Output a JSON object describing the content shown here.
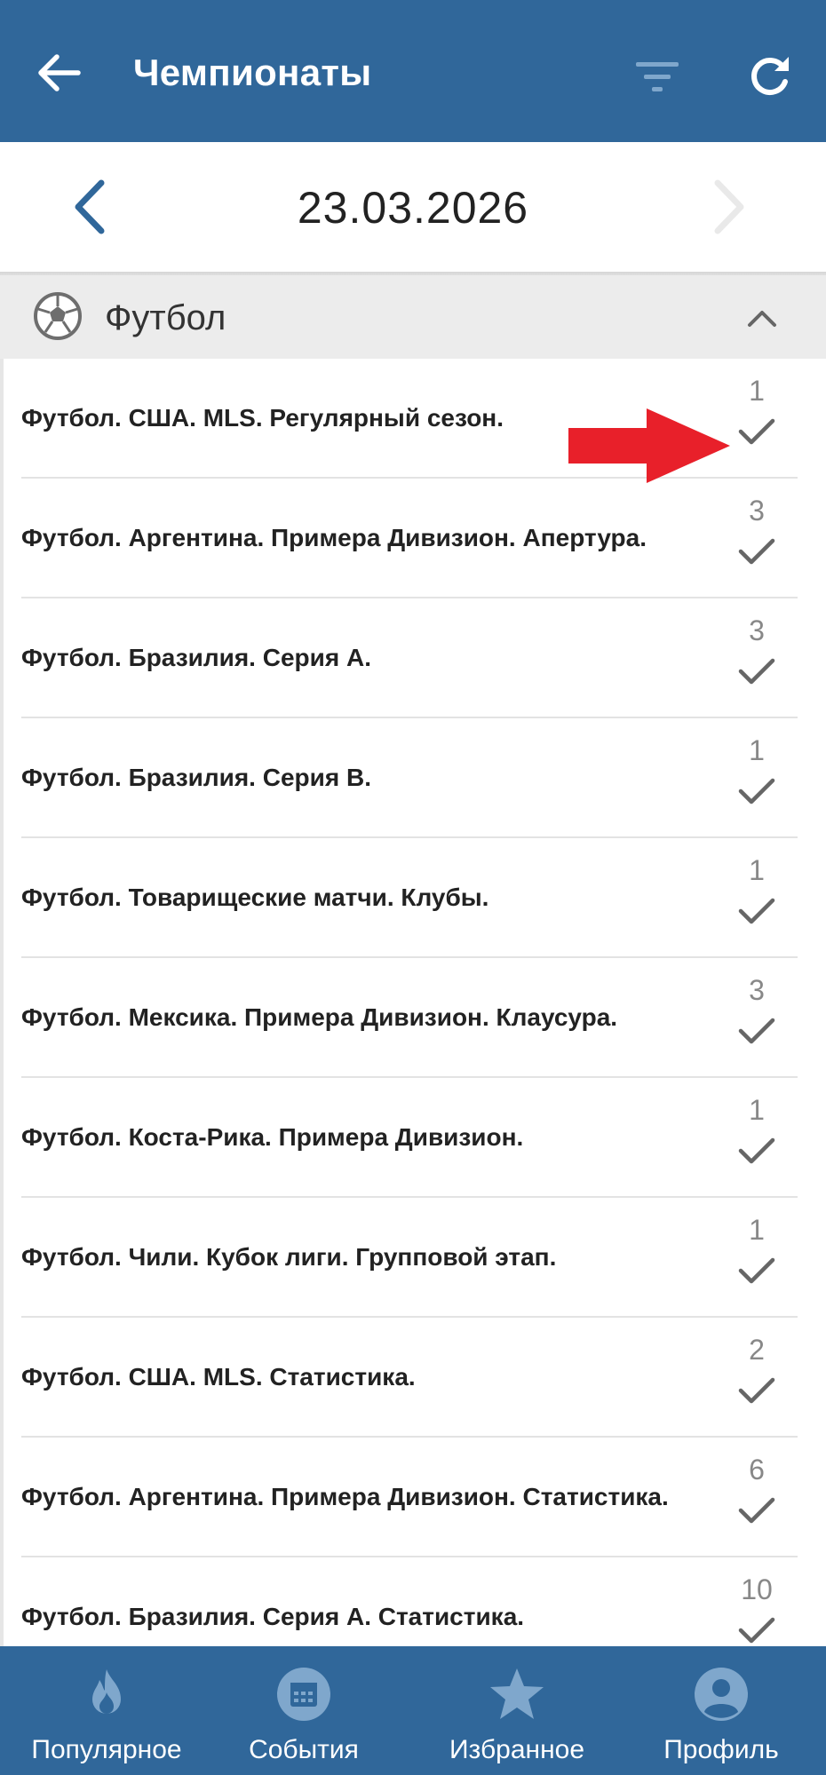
{
  "header": {
    "title": "Чемпионаты"
  },
  "date_bar": {
    "date": "23.03.2026"
  },
  "section": {
    "label": "Футбол"
  },
  "rows": [
    {
      "name": "Футбол. США. MLS. Регулярный сезон.",
      "count": "1"
    },
    {
      "name": "Футбол. Аргентина. Примера Дивизион. Апертура.",
      "count": "3"
    },
    {
      "name": "Футбол. Бразилия. Серия А.",
      "count": "3"
    },
    {
      "name": "Футбол. Бразилия. Серия В.",
      "count": "1"
    },
    {
      "name": "Футбол. Товарищеские матчи. Клубы.",
      "count": "1"
    },
    {
      "name": "Футбол. Мексика. Примера Дивизион. Клаусура.",
      "count": "3"
    },
    {
      "name": "Футбол. Коста-Рика. Примера Дивизион.",
      "count": "1"
    },
    {
      "name": "Футбол. Чили. Кубок лиги. Групповой этап.",
      "count": "1"
    },
    {
      "name": "Футбол. США. MLS. Статистика.",
      "count": "2"
    },
    {
      "name": "Футбол. Аргентина. Примера Дивизион. Статистика.",
      "count": "6"
    },
    {
      "name": "Футбол. Бразилия. Серия А. Статистика.",
      "count": "10"
    }
  ],
  "bottom_nav": [
    {
      "label": "Популярное",
      "icon": "flame-icon"
    },
    {
      "label": "События",
      "icon": "calendar-icon"
    },
    {
      "label": "Избранное",
      "icon": "star-icon"
    },
    {
      "label": "Профиль",
      "icon": "profile-icon"
    }
  ],
  "colors": {
    "header_bg": "#30679a",
    "accent": "#30679a",
    "annotation_arrow": "#e8202a"
  }
}
